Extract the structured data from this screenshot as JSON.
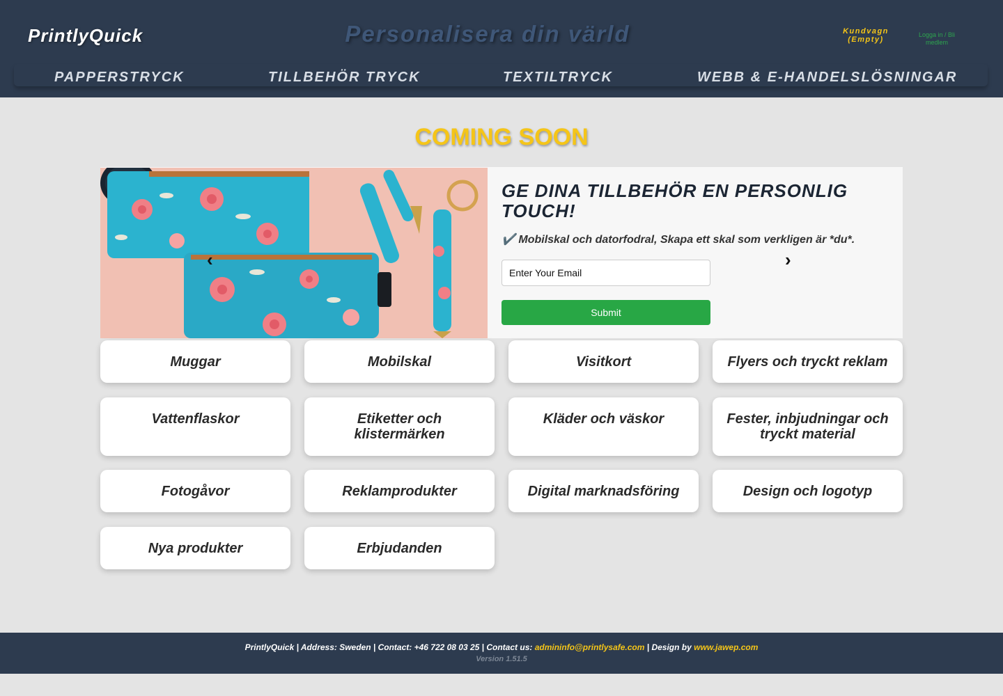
{
  "header": {
    "logo": "PrintlyQuick",
    "tagline": "Personalisera din värld",
    "cart_label": "Kundvagn",
    "cart_status": "(Empty)",
    "login_label": "Logga in / Bli medlem"
  },
  "nav": {
    "items": [
      {
        "label": "PAPPERSTRYCK"
      },
      {
        "label": "TILLBEHÖR TRYCK"
      },
      {
        "label": "TEXTILTRYCK"
      },
      {
        "label": "WEBB & E-HANDELSLÖSNINGAR"
      }
    ]
  },
  "main": {
    "coming_soon": "COMING SOON"
  },
  "hero": {
    "title": "GE DINA TILLBEHÖR EN PERSONLIG TOUCH!",
    "bullet": "✔️ Mobilskal och datorfodral, Skapa ett skal som verkligen är *du*.",
    "email_placeholder": "Enter Your Email",
    "submit_label": "Submit",
    "prev_arrow": "‹",
    "next_arrow": "›"
  },
  "categories": [
    {
      "label": "Muggar"
    },
    {
      "label": "Mobilskal"
    },
    {
      "label": "Visitkort"
    },
    {
      "label": "Flyers och tryckt reklam"
    },
    {
      "label": "Vattenflaskor"
    },
    {
      "label": "Etiketter och klistermärken"
    },
    {
      "label": "Kläder och väskor"
    },
    {
      "label": "Fester, inbjudningar och tryckt material"
    },
    {
      "label": "Fotogåvor"
    },
    {
      "label": "Reklamprodukter"
    },
    {
      "label": "Digital marknadsföring"
    },
    {
      "label": "Design och logotyp"
    },
    {
      "label": "Nya produkter"
    },
    {
      "label": "Erbjudanden"
    }
  ],
  "footer": {
    "text_prefix": "PrintlyQuick | Address: Sweden | Contact: +46 722 08 03 25 | Contact us: ",
    "email": "admininfo@printlysafe.com",
    "text_mid": " | Design by ",
    "designer": "www.jawep.com",
    "version": "Version 1.51.5"
  },
  "colors": {
    "header_bg": "#2d3b4f",
    "accent_yellow": "#f5c518",
    "submit_green": "#28a745",
    "page_bg": "#e4e4e4"
  }
}
